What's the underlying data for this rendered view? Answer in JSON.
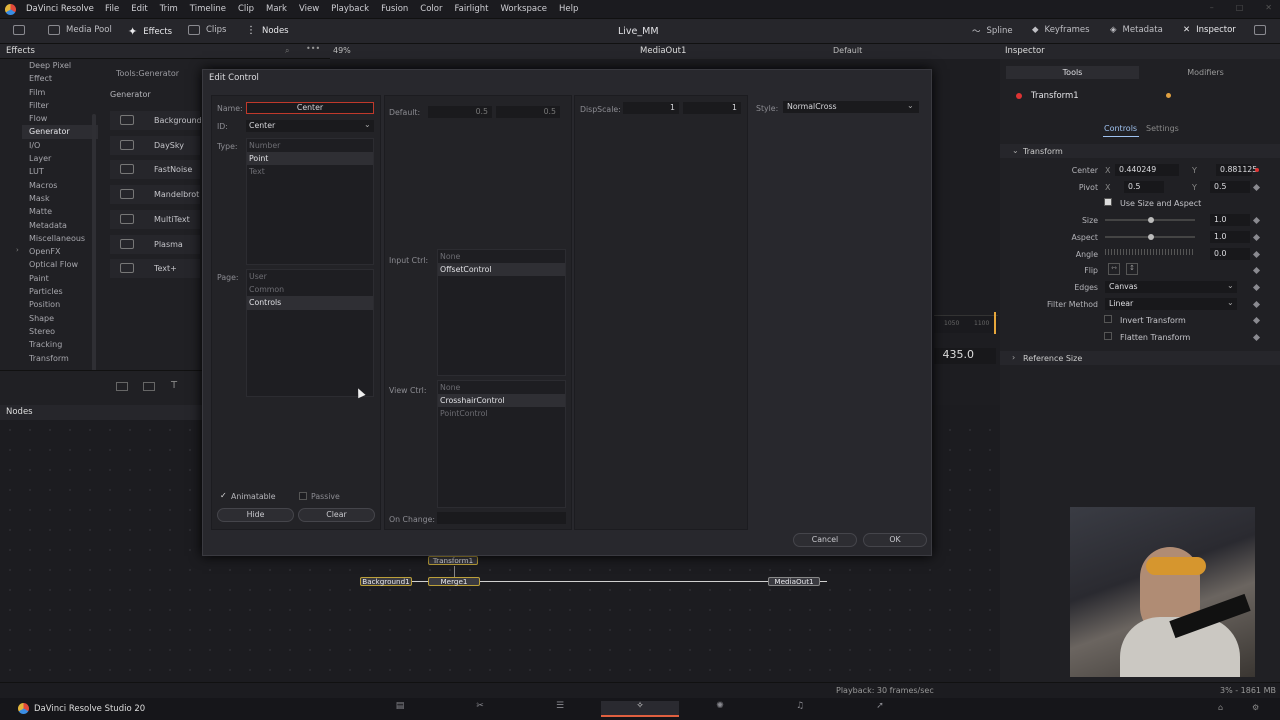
{
  "menubar": {
    "app": "DaVinci Resolve",
    "items": [
      "File",
      "Edit",
      "Trim",
      "Timeline",
      "Clip",
      "Mark",
      "View",
      "Playback",
      "Fusion",
      "Color",
      "Fairlight",
      "Workspace",
      "Help"
    ]
  },
  "toolbar": {
    "media_pool": "Media Pool",
    "effects": "Effects",
    "clips": "Clips",
    "nodes": "Nodes",
    "project": "Live_MM",
    "spline": "Spline",
    "keyframes": "Keyframes",
    "metadata": "Metadata",
    "inspector": "Inspector"
  },
  "effects": {
    "title": "Effects",
    "zoom": "49%",
    "path": "Tools:Generator",
    "section": "Generator",
    "categories": [
      "Deep Pixel",
      "Effect",
      "Film",
      "Filter",
      "Flow",
      "Generator",
      "I/O",
      "Layer",
      "LUT",
      "Macros",
      "Mask",
      "Matte",
      "Metadata",
      "Miscellaneous",
      "OpenFX",
      "Optical Flow",
      "Paint",
      "Particles",
      "Position",
      "Shape",
      "Stereo",
      "Tracking",
      "Transform"
    ],
    "generators": [
      "Background",
      "DaySky",
      "FastNoise",
      "Mandelbrot",
      "MultiText",
      "Plasma",
      "Text+"
    ]
  },
  "viewer": {
    "title": "MediaOut1",
    "default": "Default",
    "timecode": "435.0",
    "ruler": [
      "1050",
      "1100"
    ]
  },
  "nodes": {
    "title": "Nodes",
    "items": [
      "Transform1",
      "Background1",
      "Merge1",
      "MediaOut1"
    ]
  },
  "dialog": {
    "title": "Edit Control",
    "name_label": "Name:",
    "name_value": "Center",
    "id_label": "ID:",
    "id_value": "Center",
    "type_label": "Type:",
    "types": [
      "Number",
      "Point",
      "Text"
    ],
    "page_label": "Page:",
    "pages": [
      "User",
      "Common",
      "Controls"
    ],
    "animatable": "Animatable",
    "passive": "Passive",
    "hide": "Hide",
    "clear": "Clear",
    "default_label": "Default:",
    "default_x": "0.5",
    "default_y": "0.5",
    "input_label": "Input Ctrl:",
    "input_ctrls": [
      "None",
      "OffsetControl"
    ],
    "view_label": "View Ctrl:",
    "view_ctrls": [
      "None",
      "CrosshairControl",
      "PointControl"
    ],
    "onchange_label": "On Change:",
    "dispscale_label": "DispScale:",
    "dispscale_x": "1",
    "dispscale_y": "1",
    "style_label": "Style:",
    "style_value": "NormalCross",
    "cancel": "Cancel",
    "ok": "OK"
  },
  "inspector": {
    "title": "Inspector",
    "tab_tools": "Tools",
    "tab_modifiers": "Modifiers",
    "node": "Transform1",
    "controls": "Controls",
    "settings": "Settings",
    "section": "Transform",
    "center_label": "Center",
    "center_x": "0.440249",
    "center_y": "0.881125",
    "pivot_label": "Pivot",
    "pivot_x": "0.5",
    "pivot_y": "0.5",
    "use_size": "Use Size and Aspect",
    "size_label": "Size",
    "size": "1.0",
    "aspect_label": "Aspect",
    "aspect": "1.0",
    "angle_label": "Angle",
    "angle": "0.0",
    "flip_label": "Flip",
    "edges_label": "Edges",
    "edges": "Canvas",
    "filter_label": "Filter Method",
    "filter": "Linear",
    "invert": "Invert Transform",
    "flatten": "Flatten Transform",
    "ref_size": "Reference Size",
    "x": "X",
    "y": "Y"
  },
  "status": {
    "playback": "Playback: 30 frames/sec",
    "mem": "3% - 1861 MB",
    "studio": "DaVinci Resolve Studio 20"
  }
}
